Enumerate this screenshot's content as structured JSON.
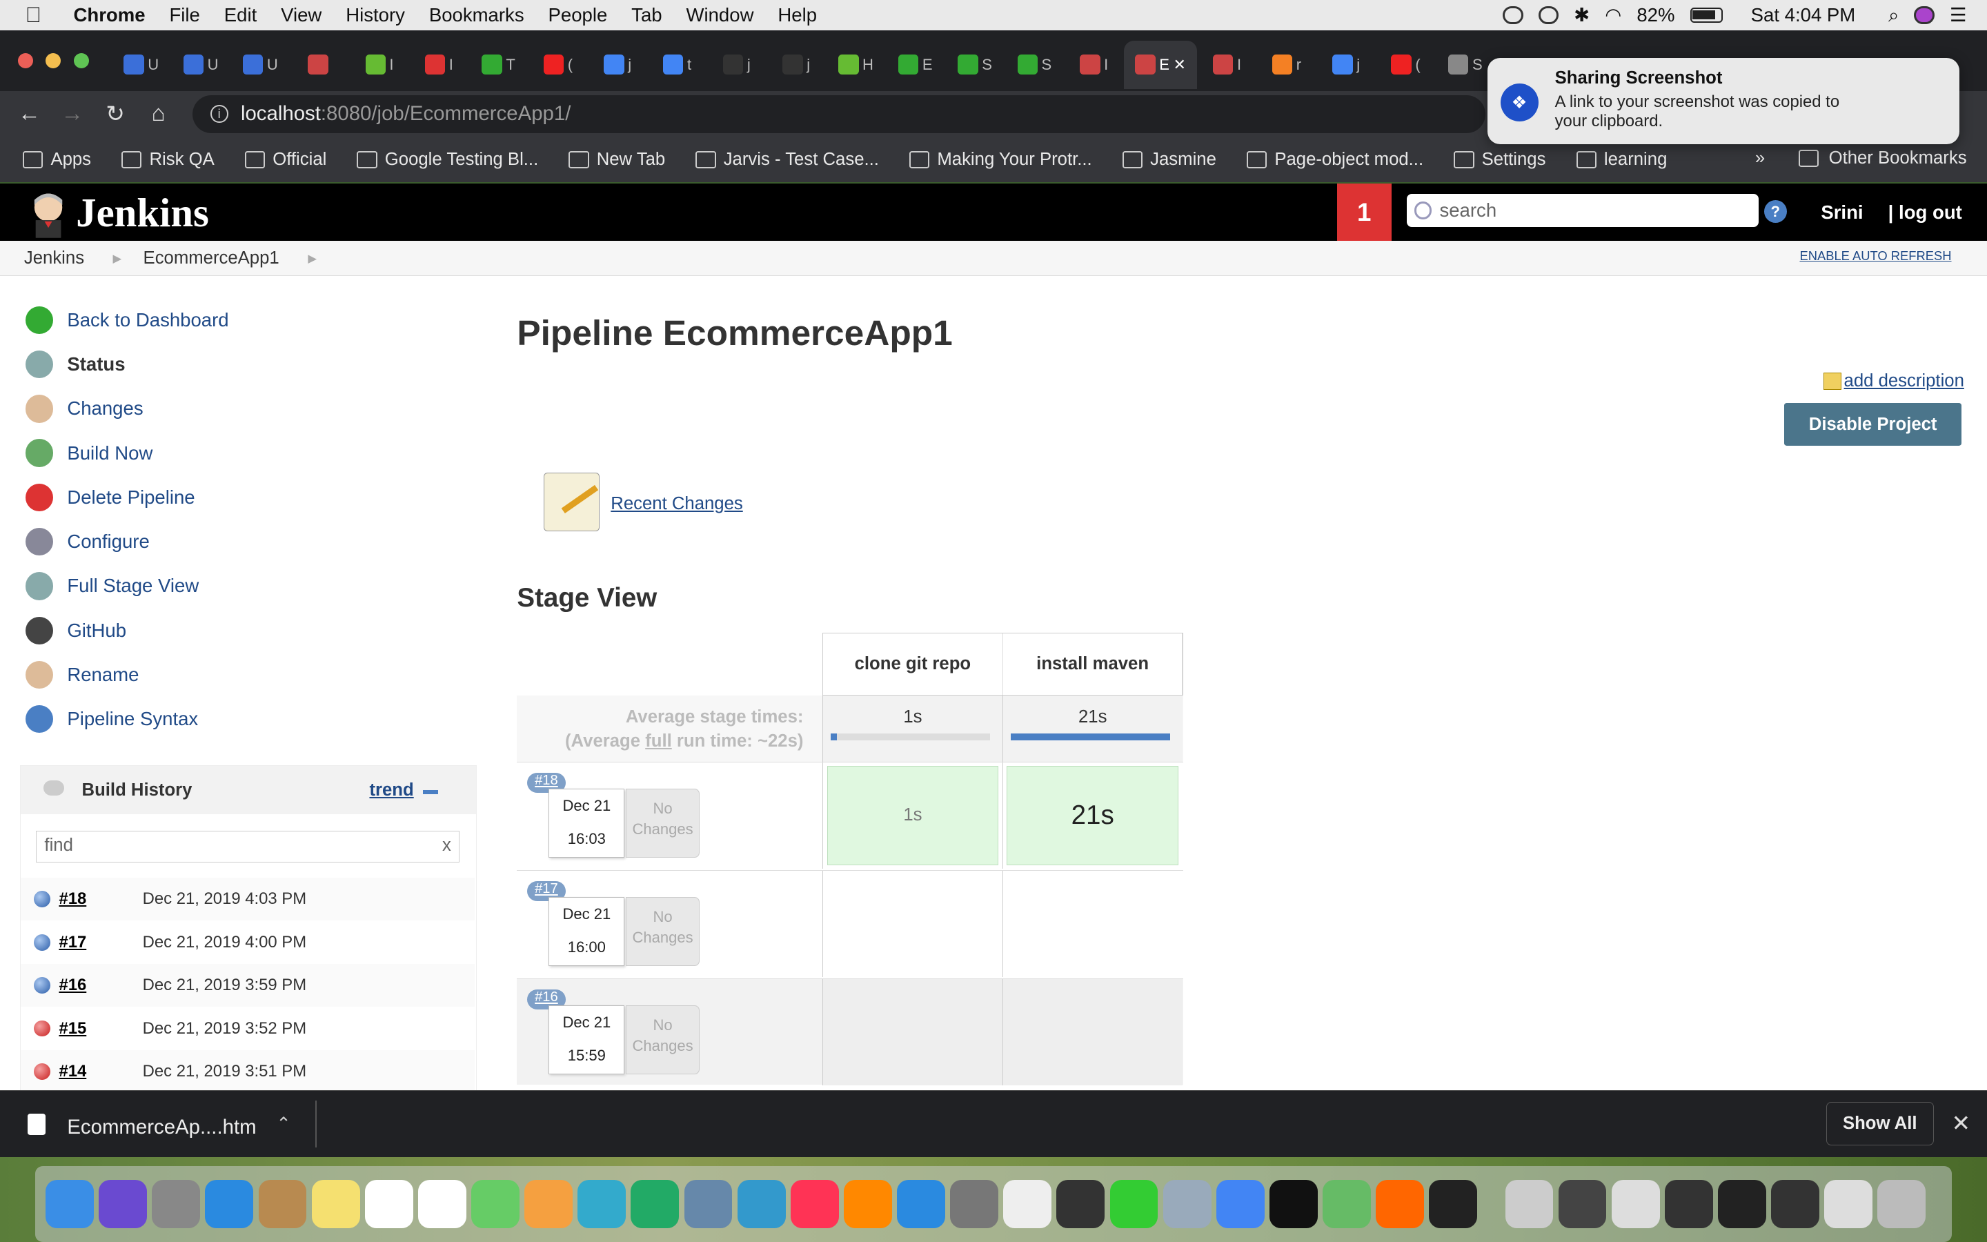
{
  "menubar": {
    "app": "Chrome",
    "items": [
      "File",
      "Edit",
      "View",
      "History",
      "Bookmarks",
      "People",
      "Tab",
      "Window",
      "Help"
    ],
    "battery": "82%",
    "clock": "Sat 4:04 PM"
  },
  "browser": {
    "tabs": [
      {
        "icon": "udemy-icon",
        "label": "U",
        "color": "#3b6fd9"
      },
      {
        "icon": "udemy-icon",
        "label": "U",
        "color": "#3b6fd9"
      },
      {
        "icon": "udemy-icon",
        "label": "U",
        "color": "#3b6fd9"
      },
      {
        "icon": "jenkins-icon",
        "label": "",
        "color": "#c44"
      },
      {
        "icon": "leaf-icon",
        "label": "I",
        "color": "#6b3"
      },
      {
        "icon": "gmail-icon",
        "label": "I",
        "color": "#d33"
      },
      {
        "icon": "terminal-icon",
        "label": "T",
        "color": "#3a3"
      },
      {
        "icon": "youtube-icon",
        "label": "(",
        "color": "#e22"
      },
      {
        "icon": "google-icon",
        "label": "j",
        "color": "#4285f4"
      },
      {
        "icon": "google-icon",
        "label": "t",
        "color": "#4285f4"
      },
      {
        "icon": "github-icon",
        "label": "j",
        "color": "#333"
      },
      {
        "icon": "github-icon",
        "label": "j",
        "color": "#333"
      },
      {
        "icon": "leaf-icon",
        "label": "H",
        "color": "#6b3"
      },
      {
        "icon": "terminal-icon",
        "label": "E",
        "color": "#3a3"
      },
      {
        "icon": "terminal-icon",
        "label": "S",
        "color": "#3a3"
      },
      {
        "icon": "terminal-icon",
        "label": "S",
        "color": "#3a3"
      },
      {
        "icon": "jenkins-icon",
        "label": "I",
        "color": "#c44"
      },
      {
        "icon": "jenkins-icon",
        "label": "E",
        "color": "#c44",
        "active": true
      },
      {
        "icon": "jenkins-icon",
        "label": "I",
        "color": "#c44"
      },
      {
        "icon": "stack-icon",
        "label": "r",
        "color": "#f48024"
      },
      {
        "icon": "google-icon",
        "label": "j",
        "color": "#4285f4"
      },
      {
        "icon": "opera-icon",
        "label": "(",
        "color": "#e22"
      },
      {
        "icon": "gear-icon",
        "label": "S",
        "color": "#888"
      }
    ],
    "active_tab_close": "✕",
    "url_host": "localhost",
    "url_path": ":8080/job/EcommerceApp1/",
    "bookmarks": [
      {
        "label": "Apps",
        "icon": "apps-grid-icon"
      },
      {
        "label": "Risk QA",
        "icon": "folder-icon"
      },
      {
        "label": "Official",
        "icon": "folder-icon"
      },
      {
        "label": "Google Testing Bl...",
        "icon": "blogger-icon"
      },
      {
        "label": "New Tab",
        "icon": "globe-icon"
      },
      {
        "label": "Jarvis - Test Case...",
        "icon": "visa-icon"
      },
      {
        "label": "Making Your Protr...",
        "icon": "medium-icon"
      },
      {
        "label": "Jasmine",
        "icon": "globe-icon"
      },
      {
        "label": "Page-object mod...",
        "icon": "medium-icon"
      },
      {
        "label": "Settings",
        "icon": "gear-icon"
      },
      {
        "label": "learning",
        "icon": "folder-icon"
      }
    ],
    "bookmarks_overflow": "»",
    "other_bookmarks": "Other Bookmarks"
  },
  "notification": {
    "title": "Sharing Screenshot",
    "body": "A link to your screenshot was copied to your clipboard."
  },
  "jenkins": {
    "brand": "Jenkins",
    "alert_count": "1",
    "search_placeholder": "search",
    "user": "Srini",
    "logout": "log out",
    "breadcrumbs": [
      "Jenkins",
      "EcommerceApp1"
    ],
    "auto_refresh": "ENABLE AUTO REFRESH",
    "tasks": [
      {
        "label": "Back to Dashboard",
        "icon": "up-arrow-icon",
        "color": "#3a3"
      },
      {
        "label": "Status",
        "icon": "magnifier-icon",
        "color": "#8aa"
      },
      {
        "label": "Changes",
        "icon": "notepad-icon",
        "color": "#db9"
      },
      {
        "label": "Build Now",
        "icon": "clock-icon",
        "color": "#6a6"
      },
      {
        "label": "Delete Pipeline",
        "icon": "no-entry-icon",
        "color": "#d33"
      },
      {
        "label": "Configure",
        "icon": "gear-icon",
        "color": "#889"
      },
      {
        "label": "Full Stage View",
        "icon": "magnifier-icon",
        "color": "#8aa"
      },
      {
        "label": "GitHub",
        "icon": "github-icon",
        "color": "#444"
      },
      {
        "label": "Rename",
        "icon": "notepad-icon",
        "color": "#db9"
      },
      {
        "label": "Pipeline Syntax",
        "icon": "help-icon",
        "color": "#4a7fc4"
      }
    ],
    "build_history": {
      "title": "Build History",
      "trend": "trend",
      "find_placeholder": "find",
      "find_clear": "x",
      "builds": [
        {
          "num": "#18",
          "date": "Dec 21, 2019 4:03 PM",
          "status": "blue"
        },
        {
          "num": "#17",
          "date": "Dec 21, 2019 4:00 PM",
          "status": "blue"
        },
        {
          "num": "#16",
          "date": "Dec 21, 2019 3:59 PM",
          "status": "blue"
        },
        {
          "num": "#15",
          "date": "Dec 21, 2019 3:52 PM",
          "status": "red"
        },
        {
          "num": "#14",
          "date": "Dec 21, 2019 3:51 PM",
          "status": "red"
        }
      ]
    },
    "title": "Pipeline EcommerceApp1",
    "add_description": "add description",
    "disable_project": "Disable Project",
    "recent_changes": "Recent Changes",
    "stage_view": {
      "heading": "Stage View",
      "stages": [
        "clone git repo",
        "install maven"
      ],
      "avg_label": "Average stage times:",
      "avg_full_prefix": "(Average ",
      "avg_full_word": "full",
      "avg_full_suffix": " run time: ~22s)",
      "avg_times": [
        "1s",
        "21s"
      ],
      "avg_progress": [
        0.04,
        1.0
      ],
      "runs": [
        {
          "num": "#18",
          "date": "Dec 21",
          "time": "16:03",
          "changes": "No Changes",
          "durations": [
            "1s",
            "21s"
          ]
        },
        {
          "num": "#17",
          "date": "Dec 21",
          "time": "16:00",
          "changes": "No Changes",
          "durations": [
            "",
            ""
          ]
        },
        {
          "num": "#16",
          "date": "Dec 21",
          "time": "15:59",
          "changes": "No Changes",
          "durations": [
            "",
            ""
          ]
        }
      ]
    }
  },
  "downloads": {
    "file": "EcommerceAp....htm",
    "show_all": "Show All",
    "close": "✕"
  },
  "dock": {
    "apps": [
      {
        "name": "finder-icon",
        "color": "#3a8ee6"
      },
      {
        "name": "siri-icon",
        "color": "#6a4ad0"
      },
      {
        "name": "launchpad-icon",
        "color": "#888"
      },
      {
        "name": "safari-icon",
        "color": "#2a8ae0"
      },
      {
        "name": "contacts-icon",
        "color": "#b88a50"
      },
      {
        "name": "notes-icon",
        "color": "#f5e070"
      },
      {
        "name": "calendar-icon",
        "color": "#fff"
      },
      {
        "name": "reminders-icon",
        "color": "#fff"
      },
      {
        "name": "maps-icon",
        "color": "#6c6"
      },
      {
        "name": "photos-icon",
        "color": "#f5a040"
      },
      {
        "name": "messages-icon",
        "color": "#3ac"
      },
      {
        "name": "numbers-icon",
        "color": "#2a6"
      },
      {
        "name": "preview-icon",
        "color": "#68a"
      },
      {
        "name": "keynote-icon",
        "color": "#39c"
      },
      {
        "name": "music-icon",
        "color": "#f35"
      },
      {
        "name": "books-icon",
        "color": "#f80"
      },
      {
        "name": "appstore-icon",
        "color": "#2a8ae0"
      },
      {
        "name": "system-preferences-icon",
        "color": "#777"
      },
      {
        "name": "textedit-icon",
        "color": "#eee"
      },
      {
        "name": "instruments-icon",
        "color": "#333"
      },
      {
        "name": "facetime-icon",
        "color": "#3c3"
      },
      {
        "name": "script-editor-icon",
        "color": "#9ab"
      },
      {
        "name": "chrome-icon",
        "color": "#4285f4"
      },
      {
        "name": "intellij-icon",
        "color": "#111"
      },
      {
        "name": "atom-icon",
        "color": "#6b6"
      },
      {
        "name": "postman-icon",
        "color": "#f60"
      },
      {
        "name": "terminal-icon",
        "color": "#222"
      },
      {
        "name": "help-icon",
        "color": "#ccc"
      },
      {
        "name": "screenshot-thumb-icon",
        "color": "#444"
      },
      {
        "name": "screenshot-thumb-icon",
        "color": "#ddd"
      },
      {
        "name": "screenshot-thumb-icon",
        "color": "#333"
      },
      {
        "name": "screenshot-thumb-icon",
        "color": "#222"
      },
      {
        "name": "screenshot-thumb-icon",
        "color": "#333"
      },
      {
        "name": "screenshot-thumb-icon",
        "color": "#ddd"
      },
      {
        "name": "trash-icon",
        "color": "#bbb"
      }
    ]
  }
}
